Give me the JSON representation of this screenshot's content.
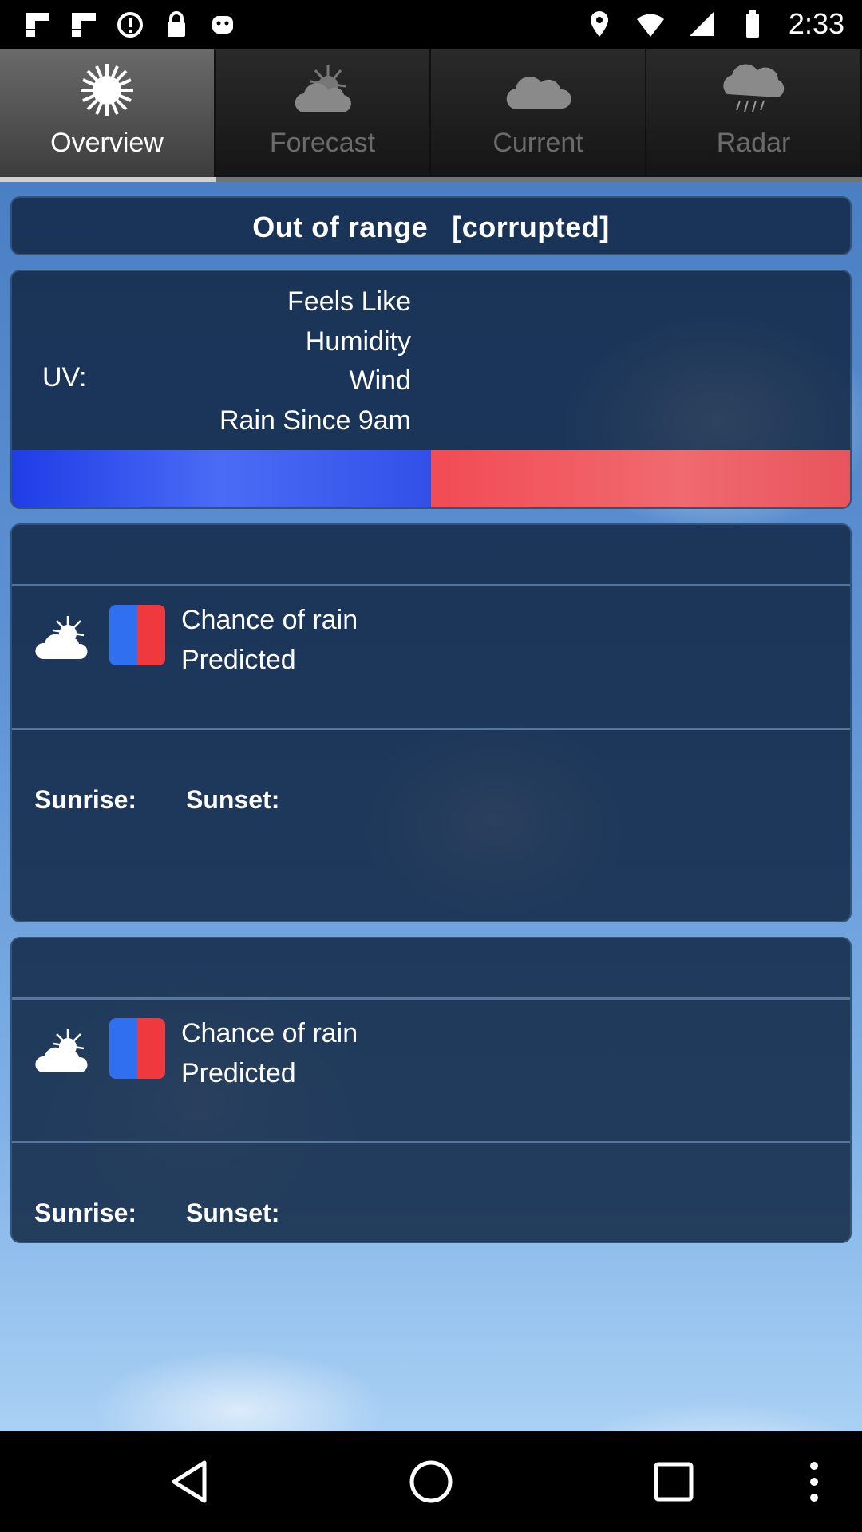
{
  "status_bar": {
    "time": "2:33",
    "left_icons": [
      "flipboard-icon",
      "flipboard-icon",
      "data-saver-icon",
      "lock-icon",
      "android-icon"
    ],
    "right_icons": [
      "location-icon",
      "wifi-icon",
      "signal-icon",
      "battery-icon"
    ]
  },
  "tabs": [
    {
      "label": "Overview",
      "icon": "sun-icon",
      "active": true
    },
    {
      "label": "Forecast",
      "icon": "sun-cloud-icon",
      "active": false
    },
    {
      "label": "Current",
      "icon": "cloud-icon",
      "active": false
    },
    {
      "label": "Radar",
      "icon": "rain-cloud-icon",
      "active": false
    }
  ],
  "header": {
    "status": "Out of range",
    "location": "[corrupted]"
  },
  "details": {
    "feels_like": "Feels Like",
    "humidity": "Humidity",
    "wind": "Wind",
    "rain_since": "Rain Since 9am",
    "uv": "UV:"
  },
  "forecast_days": [
    {
      "chance_of_rain": "Chance of rain",
      "predicted": "Predicted",
      "sunrise": "Sunrise:",
      "sunset": "Sunset:"
    },
    {
      "chance_of_rain": "Chance of rain",
      "predicted": "Predicted",
      "sunrise": "Sunrise:",
      "sunset": "Sunset:"
    }
  ],
  "colors": {
    "cold": "#2f4ff0",
    "hot": "#f25a60",
    "panel": "#112846"
  }
}
